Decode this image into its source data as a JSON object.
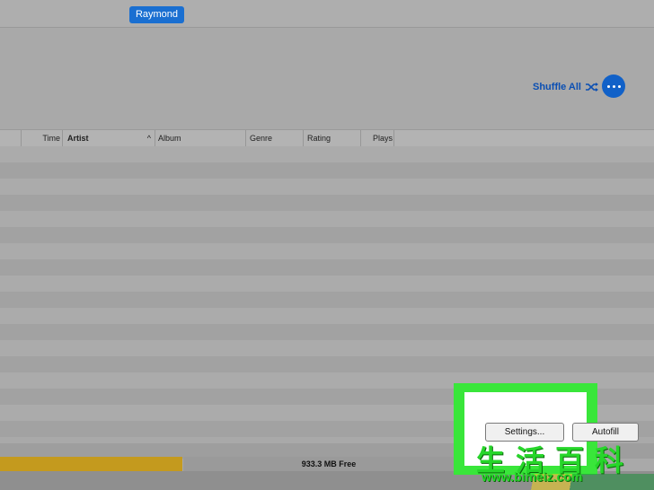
{
  "topbar": {
    "user_label": "Raymond"
  },
  "header": {
    "shuffle_label": "Shuffle All"
  },
  "columns": [
    {
      "label": "Time"
    },
    {
      "label": "Artist"
    },
    {
      "label": "Album"
    },
    {
      "label": "Genre"
    },
    {
      "label": "Rating"
    },
    {
      "label": "Plays"
    }
  ],
  "footer": {
    "free_space": "933.3 MB Free",
    "settings_label": "Settings...",
    "autofill_label": "Autofill"
  },
  "watermark": {
    "chars": "生活百科",
    "url": "www.bimeiz.com"
  },
  "colors": {
    "accent": "#1a6fd1",
    "storage_used": "#c49a1e",
    "highlight": "#39e63a"
  }
}
